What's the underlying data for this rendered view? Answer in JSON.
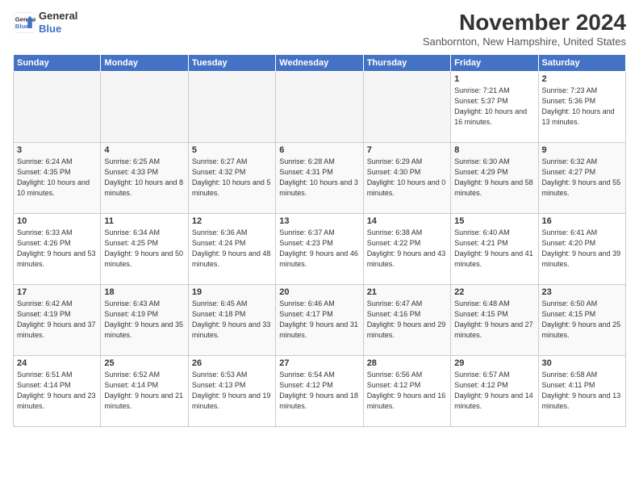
{
  "logo": {
    "line1": "General",
    "line2": "Blue"
  },
  "title": "November 2024",
  "location": "Sanbornton, New Hampshire, United States",
  "headers": [
    "Sunday",
    "Monday",
    "Tuesday",
    "Wednesday",
    "Thursday",
    "Friday",
    "Saturday"
  ],
  "weeks": [
    [
      {
        "day": "",
        "info": ""
      },
      {
        "day": "",
        "info": ""
      },
      {
        "day": "",
        "info": ""
      },
      {
        "day": "",
        "info": ""
      },
      {
        "day": "",
        "info": ""
      },
      {
        "day": "1",
        "info": "Sunrise: 7:21 AM\nSunset: 5:37 PM\nDaylight: 10 hours\nand 16 minutes."
      },
      {
        "day": "2",
        "info": "Sunrise: 7:23 AM\nSunset: 5:36 PM\nDaylight: 10 hours\nand 13 minutes."
      }
    ],
    [
      {
        "day": "3",
        "info": "Sunrise: 6:24 AM\nSunset: 4:35 PM\nDaylight: 10 hours\nand 10 minutes."
      },
      {
        "day": "4",
        "info": "Sunrise: 6:25 AM\nSunset: 4:33 PM\nDaylight: 10 hours\nand 8 minutes."
      },
      {
        "day": "5",
        "info": "Sunrise: 6:27 AM\nSunset: 4:32 PM\nDaylight: 10 hours\nand 5 minutes."
      },
      {
        "day": "6",
        "info": "Sunrise: 6:28 AM\nSunset: 4:31 PM\nDaylight: 10 hours\nand 3 minutes."
      },
      {
        "day": "7",
        "info": "Sunrise: 6:29 AM\nSunset: 4:30 PM\nDaylight: 10 hours\nand 0 minutes."
      },
      {
        "day": "8",
        "info": "Sunrise: 6:30 AM\nSunset: 4:29 PM\nDaylight: 9 hours\nand 58 minutes."
      },
      {
        "day": "9",
        "info": "Sunrise: 6:32 AM\nSunset: 4:27 PM\nDaylight: 9 hours\nand 55 minutes."
      }
    ],
    [
      {
        "day": "10",
        "info": "Sunrise: 6:33 AM\nSunset: 4:26 PM\nDaylight: 9 hours\nand 53 minutes."
      },
      {
        "day": "11",
        "info": "Sunrise: 6:34 AM\nSunset: 4:25 PM\nDaylight: 9 hours\nand 50 minutes."
      },
      {
        "day": "12",
        "info": "Sunrise: 6:36 AM\nSunset: 4:24 PM\nDaylight: 9 hours\nand 48 minutes."
      },
      {
        "day": "13",
        "info": "Sunrise: 6:37 AM\nSunset: 4:23 PM\nDaylight: 9 hours\nand 46 minutes."
      },
      {
        "day": "14",
        "info": "Sunrise: 6:38 AM\nSunset: 4:22 PM\nDaylight: 9 hours\nand 43 minutes."
      },
      {
        "day": "15",
        "info": "Sunrise: 6:40 AM\nSunset: 4:21 PM\nDaylight: 9 hours\nand 41 minutes."
      },
      {
        "day": "16",
        "info": "Sunrise: 6:41 AM\nSunset: 4:20 PM\nDaylight: 9 hours\nand 39 minutes."
      }
    ],
    [
      {
        "day": "17",
        "info": "Sunrise: 6:42 AM\nSunset: 4:19 PM\nDaylight: 9 hours\nand 37 minutes."
      },
      {
        "day": "18",
        "info": "Sunrise: 6:43 AM\nSunset: 4:19 PM\nDaylight: 9 hours\nand 35 minutes."
      },
      {
        "day": "19",
        "info": "Sunrise: 6:45 AM\nSunset: 4:18 PM\nDaylight: 9 hours\nand 33 minutes."
      },
      {
        "day": "20",
        "info": "Sunrise: 6:46 AM\nSunset: 4:17 PM\nDaylight: 9 hours\nand 31 minutes."
      },
      {
        "day": "21",
        "info": "Sunrise: 6:47 AM\nSunset: 4:16 PM\nDaylight: 9 hours\nand 29 minutes."
      },
      {
        "day": "22",
        "info": "Sunrise: 6:48 AM\nSunset: 4:15 PM\nDaylight: 9 hours\nand 27 minutes."
      },
      {
        "day": "23",
        "info": "Sunrise: 6:50 AM\nSunset: 4:15 PM\nDaylight: 9 hours\nand 25 minutes."
      }
    ],
    [
      {
        "day": "24",
        "info": "Sunrise: 6:51 AM\nSunset: 4:14 PM\nDaylight: 9 hours\nand 23 minutes."
      },
      {
        "day": "25",
        "info": "Sunrise: 6:52 AM\nSunset: 4:14 PM\nDaylight: 9 hours\nand 21 minutes."
      },
      {
        "day": "26",
        "info": "Sunrise: 6:53 AM\nSunset: 4:13 PM\nDaylight: 9 hours\nand 19 minutes."
      },
      {
        "day": "27",
        "info": "Sunrise: 6:54 AM\nSunset: 4:12 PM\nDaylight: 9 hours\nand 18 minutes."
      },
      {
        "day": "28",
        "info": "Sunrise: 6:56 AM\nSunset: 4:12 PM\nDaylight: 9 hours\nand 16 minutes."
      },
      {
        "day": "29",
        "info": "Sunrise: 6:57 AM\nSunset: 4:12 PM\nDaylight: 9 hours\nand 14 minutes."
      },
      {
        "day": "30",
        "info": "Sunrise: 6:58 AM\nSunset: 4:11 PM\nDaylight: 9 hours\nand 13 minutes."
      }
    ]
  ]
}
